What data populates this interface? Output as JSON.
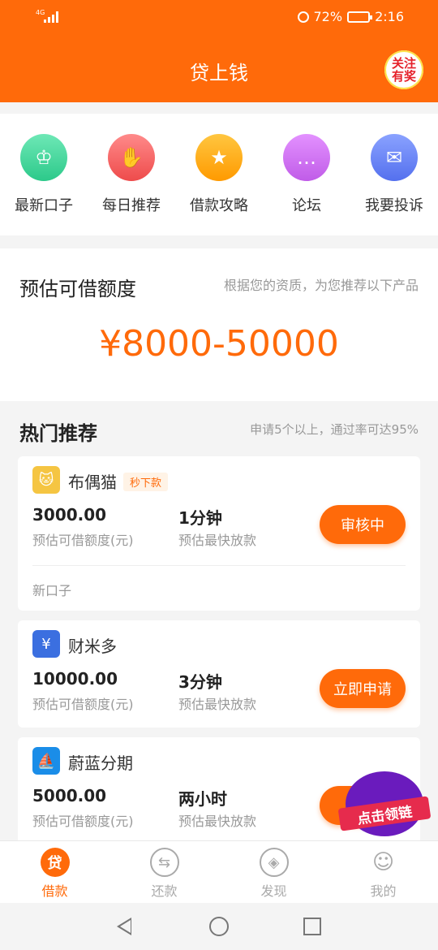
{
  "status": {
    "network": "4G",
    "battery": "72%",
    "time": "2:16"
  },
  "header": {
    "title": "贷上钱",
    "follow_badge": "关注有奖"
  },
  "quick_links": [
    {
      "label": "最新口子",
      "icon": "crown-icon",
      "color": "#39d49a",
      "glyph": "♔"
    },
    {
      "label": "每日推荐",
      "icon": "thumbs-up-icon",
      "color": "#f45a5a",
      "glyph": "👍"
    },
    {
      "label": "借款攻略",
      "icon": "guide-book-icon",
      "color": "#ffaa00",
      "glyph": "★"
    },
    {
      "label": "论坛",
      "icon": "chat-bubble-icon",
      "color": "#cc66ee",
      "glyph": "…"
    },
    {
      "label": "我要投诉",
      "icon": "mail-icon",
      "color": "#5f7ef4",
      "glyph": "✉"
    }
  ],
  "quota": {
    "title": "预估可借额度",
    "subtitle": "根据您的资质，为您推荐以下产品",
    "range": "¥8000-50000"
  },
  "hot": {
    "title": "热门推荐",
    "subtitle": "申请5个以上，通过率可达95%"
  },
  "products": [
    {
      "name": "布偶猫",
      "tag": "秒下款",
      "amount": "3000.00",
      "amount_label": "预估可借额度(元)",
      "speed": "1分钟",
      "speed_label": "预估最快放款",
      "button": "审核中",
      "note": "新口子",
      "logo_color": "#f5c542",
      "logo_glyph": "猫"
    },
    {
      "name": "财米多",
      "tag": "",
      "amount": "10000.00",
      "amount_label": "预估可借额度(元)",
      "speed": "3分钟",
      "speed_label": "预估最快放款",
      "button": "立即申请",
      "note": "",
      "logo_color": "#3b6fe0",
      "logo_glyph": "米"
    },
    {
      "name": "蔚蓝分期",
      "tag": "",
      "amount": "5000.00",
      "amount_label": "预估可借额度(元)",
      "speed": "两小时",
      "speed_label": "预估最快放款",
      "button": "立",
      "note": "",
      "logo_color": "#1a8de8",
      "logo_glyph": "蓝"
    }
  ],
  "promo": {
    "label": "点击领链"
  },
  "tabs": [
    {
      "label": "借款",
      "active": true,
      "glyph": "贷"
    },
    {
      "label": "还款",
      "active": false,
      "glyph": "⇆"
    },
    {
      "label": "发现",
      "active": false,
      "glyph": "◎"
    },
    {
      "label": "我的",
      "active": false,
      "glyph": "☺"
    }
  ],
  "colors": {
    "accent": "#ff6a0a",
    "muted": "#999999",
    "background": "#f4f4f4"
  }
}
